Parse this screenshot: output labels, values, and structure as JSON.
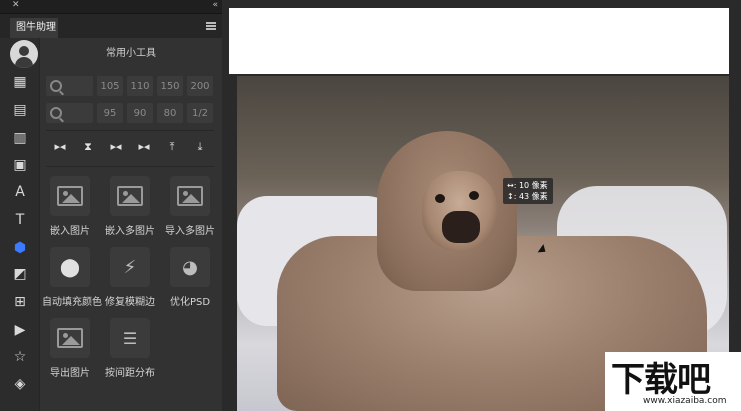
{
  "panel": {
    "tab_label": "图牛助理",
    "section_title": "常用小工具",
    "zoom_in_row": [
      "105",
      "110",
      "150",
      "200"
    ],
    "zoom_out_row": [
      "95",
      "90",
      "80",
      "1/2"
    ]
  },
  "tools": [
    {
      "label": "嵌入图片",
      "icon": "image-embed-icon"
    },
    {
      "label": "嵌入多图片",
      "icon": "images-embed-icon"
    },
    {
      "label": "导入多图片",
      "icon": "images-import-icon"
    },
    {
      "label": "自动填充颜色",
      "icon": "color-fill-icon"
    },
    {
      "label": "修复模糊边",
      "icon": "magic-wand-icon"
    },
    {
      "label": "优化PSD",
      "icon": "palette-icon"
    },
    {
      "label": "导出图片",
      "icon": "jpg-export-icon"
    },
    {
      "label": "按间距分布",
      "icon": "distribute-spacing-icon"
    }
  ],
  "measure": {
    "horizontal": "↔: 10 像素",
    "vertical": "↕: 43 像素"
  },
  "watermark": {
    "main": "下载吧",
    "sub": "www.xiazaiba.com"
  }
}
